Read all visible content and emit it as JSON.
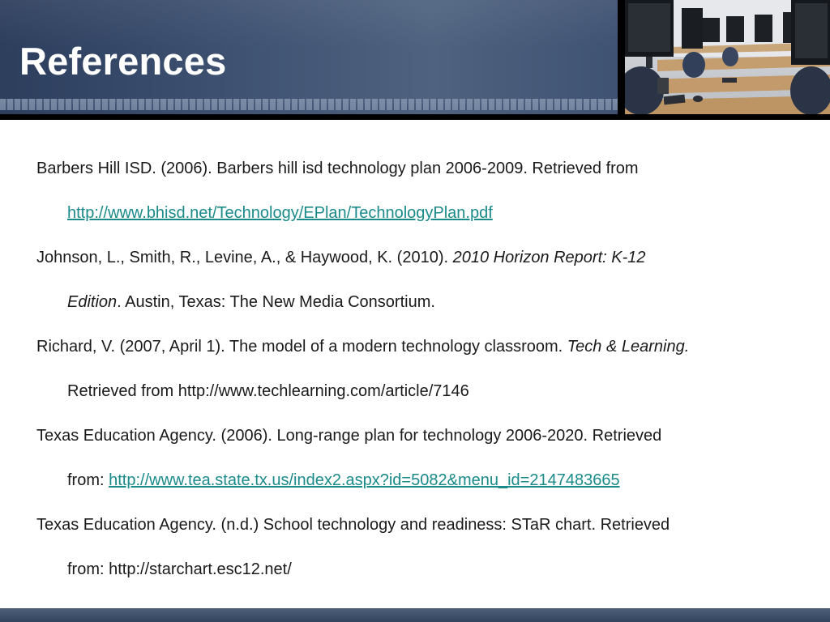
{
  "slide": {
    "title": "References"
  },
  "references": [
    {
      "line1": "Barbers Hill ISD. (2006). Barbers hill isd technology plan 2006-2009. Retrieved from",
      "line2_link": "http://www.bhisd.net/Technology/EPlan/TechnologyPlan.pdf"
    },
    {
      "line1_text": "Johnson, L., Smith, R., Levine, A., & Haywood, K. (2010). ",
      "line1_italic": "2010 Horizon Report: K-12",
      "line2_italic": "Edition",
      "line2_text": ". Austin, Texas: The New Media Consortium."
    },
    {
      "line1_text": "Richard, V. (2007, April 1). The model of a modern technology classroom. ",
      "line1_italic": "Tech & Learning.",
      "line2_text": "Retrieved from http://www.techlearning.com/article/7146"
    },
    {
      "line1": "Texas Education Agency. (2006). Long-range plan for technology 2006-2020. Retrieved",
      "line2_text": "from: ",
      "line2_link": "http://www.tea.state.tx.us/index2.aspx?id=5082&menu_id=2147483665"
    },
    {
      "line1": "Texas Education Agency. (n.d.) School technology and readiness: STaR chart. Retrieved",
      "line2_text": "from: http://starchart.esc12.net/"
    }
  ],
  "colors": {
    "header_blue": "#3d5070",
    "link": "#1b8a8a",
    "footer": "#3f506c"
  }
}
